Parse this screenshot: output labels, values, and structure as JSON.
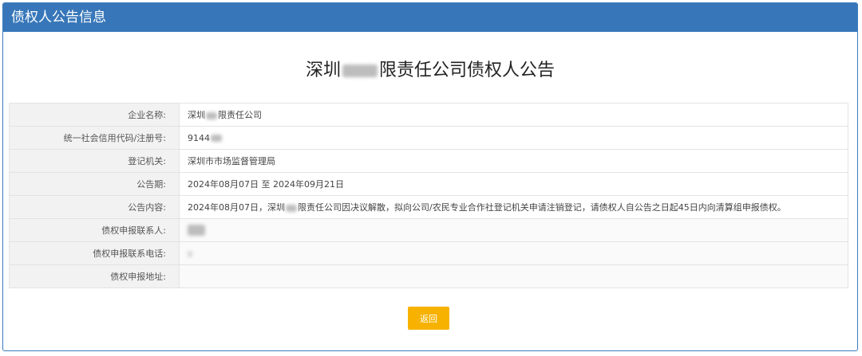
{
  "header": {
    "title": "债权人公告信息"
  },
  "announcement": {
    "title_prefix": "深圳",
    "title_suffix": "限责任公司债权人公告"
  },
  "rows": [
    {
      "label": "企业名称:",
      "value_prefix": "深圳",
      "value_suffix": "限责任公司"
    },
    {
      "label": "统一社会信用代码/注册号:",
      "value_prefix": "9144"
    },
    {
      "label": "登记机关:",
      "value": "深圳市市场监督管理局"
    },
    {
      "label": "公告期:",
      "value": "2024年08月07日 至 2024年09月21日"
    },
    {
      "label": "公告内容:",
      "value_prefix": "2024年08月07日，深圳",
      "value_suffix": "限责任公司因决议解散，拟向公司/农民专业合作社登记机关申请注销登记，请债权人自公告之日起45日内向清算组申报债权。"
    },
    {
      "label": "债权申报联系人:"
    },
    {
      "label": "债权申报联系电话:"
    },
    {
      "label": "债权申报地址:"
    }
  ],
  "buttons": {
    "return_label": "返回"
  },
  "colors": {
    "header_bg": "#3777b9",
    "button_bg": "#f7b200",
    "label_bg": "#f2f2f2"
  }
}
